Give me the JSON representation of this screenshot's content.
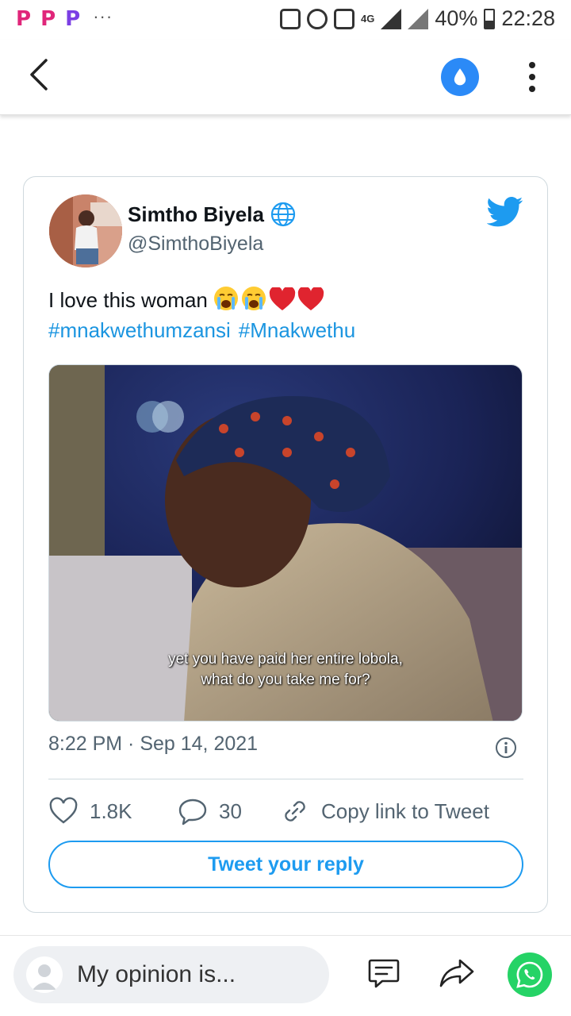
{
  "status_bar": {
    "app_icons": [
      "P",
      "P",
      "P"
    ],
    "overflow": "···",
    "network": "4G",
    "battery": "40%",
    "time": "22:28"
  },
  "toolbar": {
    "back_icon": "chevron-left-icon",
    "accent_color": "#2b8af7",
    "drop_icon": "water-drop-icon",
    "menu_icon": "more-vertical-icon"
  },
  "tweet": {
    "author_name": "Simtho Biyela",
    "author_handle": "@SimthoBiyela",
    "text": "I love this woman",
    "emojis": [
      "loudly-crying-face",
      "loudly-crying-face",
      "red-heart",
      "red-heart"
    ],
    "hashtags": [
      "#mnakwethumzansi",
      "#Mnakwethu"
    ],
    "media_caption_line1": "yet you have paid her entire lobola,",
    "media_caption_line2": "what do you take me for?",
    "timestamp": "8:22 PM · Sep 14, 2021",
    "likes": "1.8K",
    "replies": "30",
    "copy_link_label": "Copy link to Tweet",
    "reply_button_label": "Tweet your reply",
    "link_color": "#1b95e0"
  },
  "bottom_bar": {
    "opinion_placeholder": "My opinion is...",
    "whatsapp_color": "#25d366"
  }
}
